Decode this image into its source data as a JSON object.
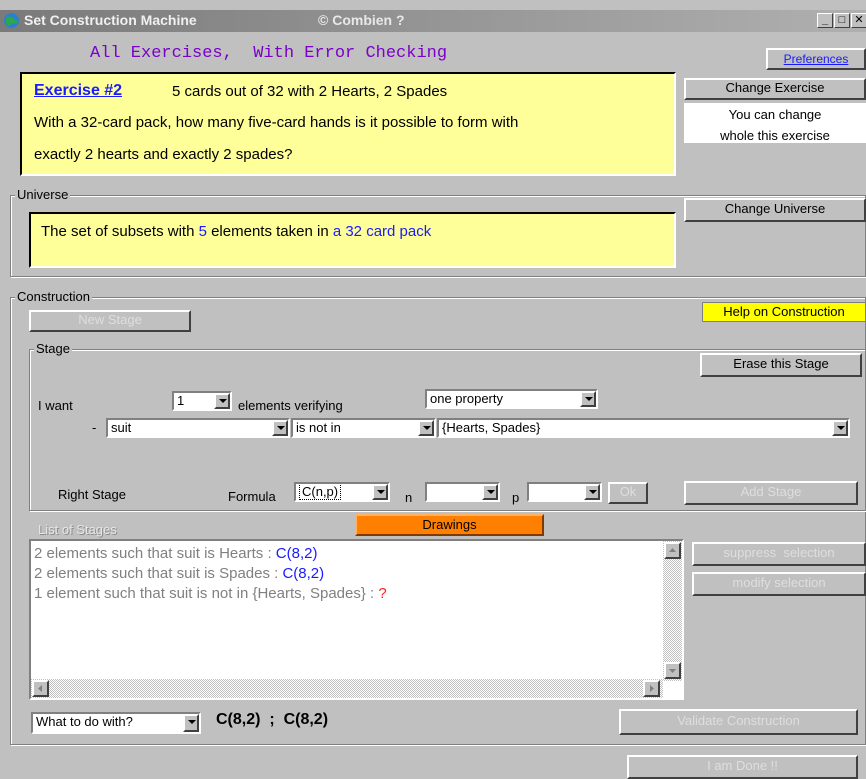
{
  "window": {
    "title": "Set Construction Machine",
    "subtitle": "© Combien ?",
    "btn_minimize": "_",
    "btn_maximize": "□",
    "btn_close": "✕"
  },
  "header": {
    "mode_text": "All Exercises,  With Error Checking",
    "preferences": "Preferences"
  },
  "exercise": {
    "number": "Exercise #2",
    "short": "5 cards out of 32 with 2 Hearts, 2 Spades",
    "line2": "With a 32-card pack, how many five-card hands is it possible to form with",
    "line3": "exactly 2 hearts and exactly 2 spades?",
    "change_button": "Change Exercise",
    "change_note": "You can change",
    "change_note_cut": "whole this exercise"
  },
  "universe": {
    "group_label": "Universe",
    "text_prefix": "The set of subsets with ",
    "count": "5",
    "text_mid": " elements taken in ",
    "pack": "a 32 card pack",
    "change_button": "Change Universe"
  },
  "construction": {
    "group_label": "Construction",
    "new_stage": "New Stage",
    "help": "Help on Construction",
    "stage_group_label": "Stage",
    "erase": "Erase this Stage",
    "i_want": "I want",
    "count_value": "1",
    "elements_verifying": "elements verifying",
    "property_value": "one property",
    "dash": "-",
    "attr_value": "suit",
    "relation_value": "is not in",
    "set_value": "{Hearts, Spades}",
    "right_stage": "Right Stage",
    "formula_label": "Formula",
    "formula_value": "C(n,p)",
    "n_label": "n",
    "n_value": "",
    "p_label": "p",
    "p_value": "",
    "ok": "Ok",
    "add_stage": "Add Stage",
    "list_label": "List of Stages",
    "drawings": "Drawings",
    "stages": [
      {
        "text": "2 elements such that suit is Hearts : ",
        "formula": "C(8,2)",
        "formula_color": "#1a1aff"
      },
      {
        "text": "2 elements such that suit is Spades : ",
        "formula": "C(8,2)",
        "formula_color": "#1a1aff"
      },
      {
        "text": "1 element such that suit is not in {Hearts, Spades} : ",
        "formula": "?",
        "formula_color": "#ff2020"
      }
    ],
    "suppress": "suppress  selection",
    "modify": "modify selection",
    "what_to_do": "What to do with?",
    "result": "C(8,2)  ;  C(8,2)",
    "validate": "Validate Construction",
    "done": "I am Done !!"
  },
  "colors": {
    "panel_yellow": "#ffff99",
    "help_yellow": "#ffff00",
    "drawings_orange": "#ff7f00",
    "link_blue": "#1a1aff",
    "header_purple": "#7b00c8"
  }
}
